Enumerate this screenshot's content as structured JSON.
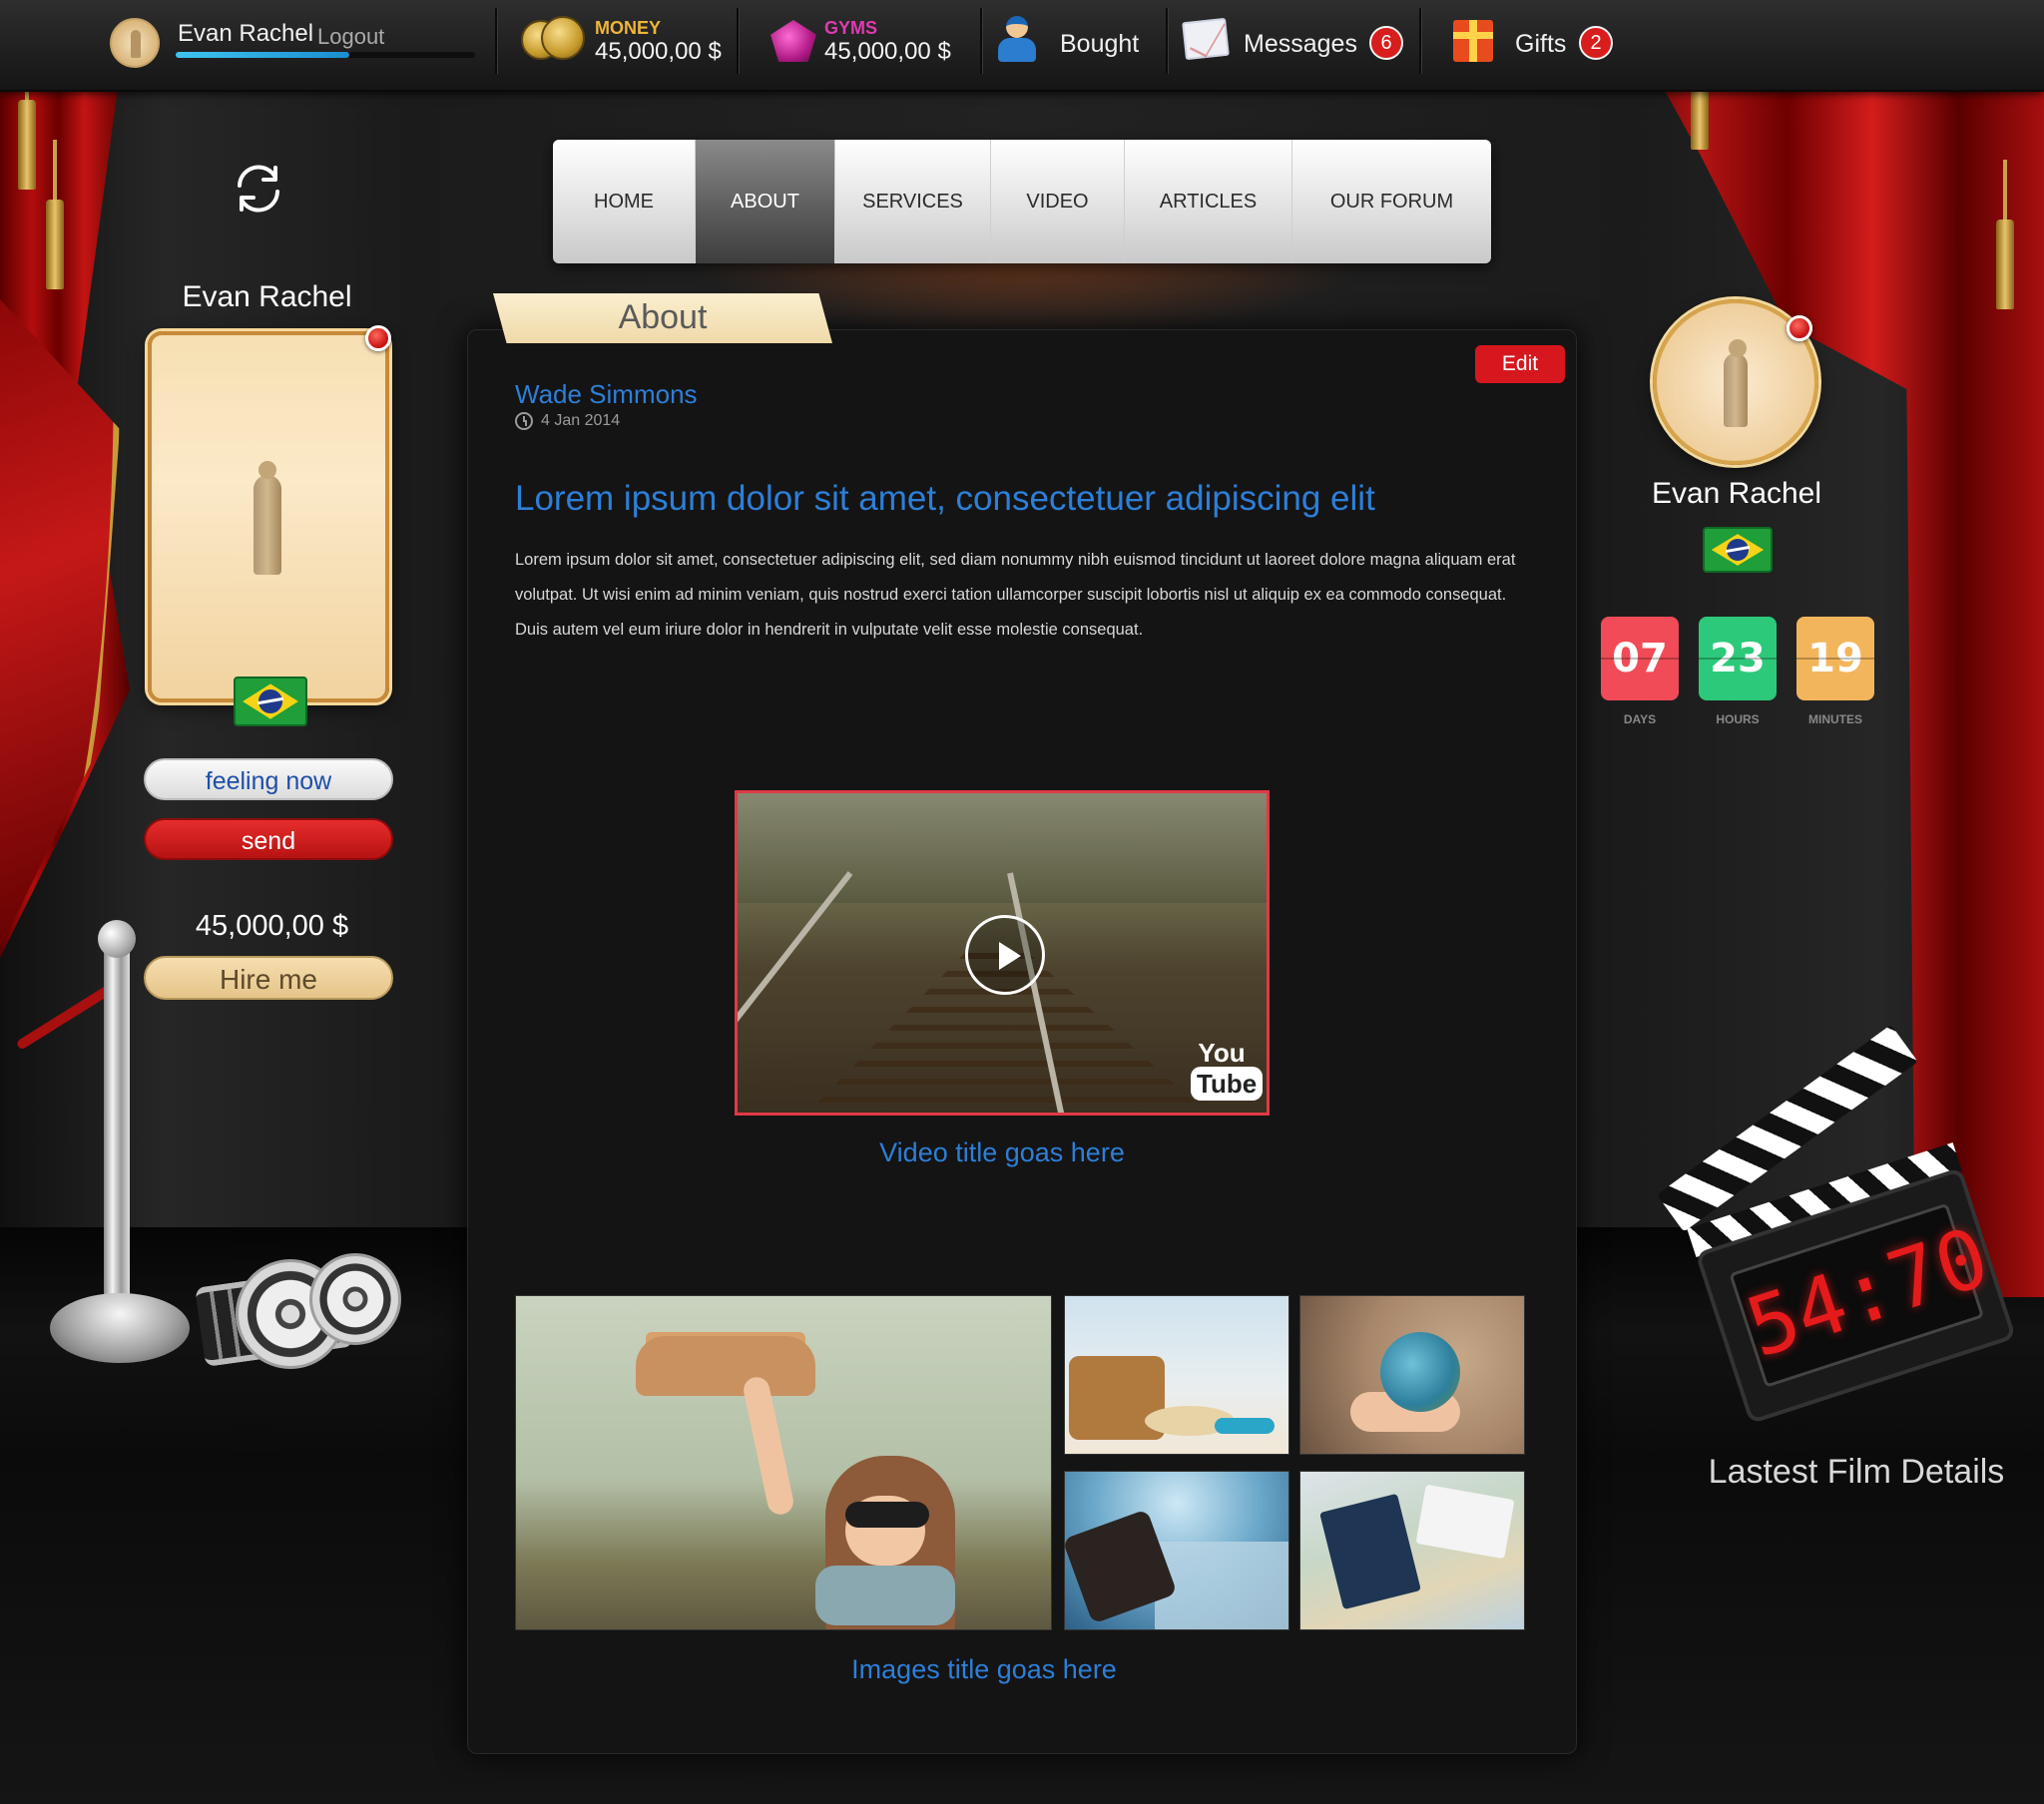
{
  "topbar": {
    "user_name": "Evan Rachel",
    "logout_label": "Logout",
    "progress": 0.58,
    "money_label": "MONEY",
    "money_value": "45,000,00 $",
    "gyms_label": "GYMS",
    "gyms_value": "45,000,00 $",
    "bought_label": "Bought",
    "messages_label": "Messages",
    "messages_count": "6",
    "gifts_label": "Gifts",
    "gifts_count": "2"
  },
  "nav": {
    "items": [
      "HOME",
      "ABOUT",
      "SERVICES",
      "VIDEO",
      "ARTICLES",
      "OUR FORUM"
    ],
    "active": "ABOUT"
  },
  "left": {
    "name": "Evan Rachel",
    "feeling_label": "feeling now",
    "send_label": "send",
    "money": "45,000,00 $",
    "hire_label": "Hire me"
  },
  "content": {
    "tab_label": "About",
    "edit_label": "Edit",
    "author": "Wade Simmons",
    "date": "4 Jan 2014",
    "title": "Lorem ipsum dolor sit amet, consectetuer adipiscing elit",
    "body": "Lorem ipsum dolor sit amet, consectetuer adipiscing elit, sed diam nonummy nibh euismod tincidunt ut laoreet dolore magna aliquam erat volutpat. Ut wisi enim ad minim veniam, quis nostrud exerci tation ullamcorper suscipit lobortis nisl ut aliquip ex ea commodo consequat. Duis autem vel eum iriure dolor in hendrerit in vulputate velit esse molestie consequat.",
    "video_logo_top": "You",
    "video_logo_bottom": "Tube",
    "video_title": "Video title goas here",
    "images_title": "Images title goas here"
  },
  "right": {
    "name": "Evan Rachel",
    "countdown": [
      {
        "value": "07",
        "label": "DAYS",
        "color": "#f04b57"
      },
      {
        "value": "23",
        "label": "HOURS",
        "color": "#2cc97a"
      },
      {
        "value": "19",
        "label": "MINUTES",
        "color": "#f3b55c"
      }
    ],
    "clapper_time": "54:70",
    "film_details_label": "Lastest Film Details"
  },
  "colors": {
    "accent_blue": "#2d7fd8",
    "accent_red": "#d7171e",
    "money_gold": "#f0b43a",
    "gyms_pink": "#e03ab0"
  }
}
